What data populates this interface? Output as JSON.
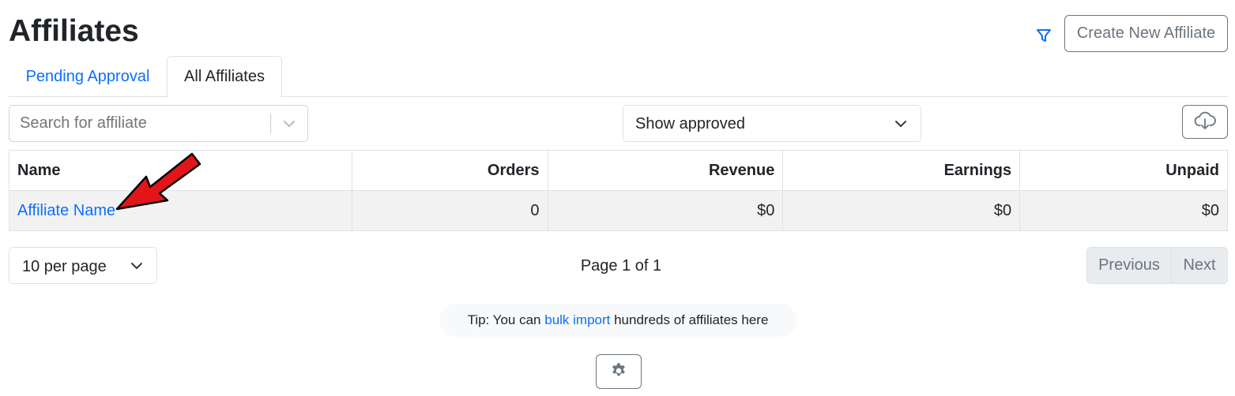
{
  "header": {
    "title": "Affiliates",
    "create_button_label": "Create New Affiliate",
    "filter_icon": "filter-icon"
  },
  "tabs": [
    {
      "label": "Pending Approval",
      "active": false
    },
    {
      "label": "All Affiliates",
      "active": true
    }
  ],
  "toolbar": {
    "search_placeholder": "Search for affiliate",
    "status_filter_value": "Show approved",
    "download_icon": "cloud-download-icon"
  },
  "table": {
    "columns": [
      "Name",
      "Orders",
      "Revenue",
      "Earnings",
      "Unpaid"
    ],
    "rows": [
      {
        "name": "Affiliate Name",
        "orders": "0",
        "revenue": "$0",
        "earnings": "$0",
        "unpaid": "$0"
      }
    ]
  },
  "pagination": {
    "per_page_value": "10 per page",
    "page_info": "Page 1 of 1",
    "previous_label": "Previous",
    "next_label": "Next"
  },
  "tip": {
    "prefix": "Tip: You can ",
    "link_text": "bulk import",
    "suffix": " hundreds of affiliates here"
  },
  "footer": {
    "settings_icon": "gear-icon"
  },
  "colors": {
    "accent": "#0d6efd",
    "annotation_arrow": "#e3151a"
  }
}
